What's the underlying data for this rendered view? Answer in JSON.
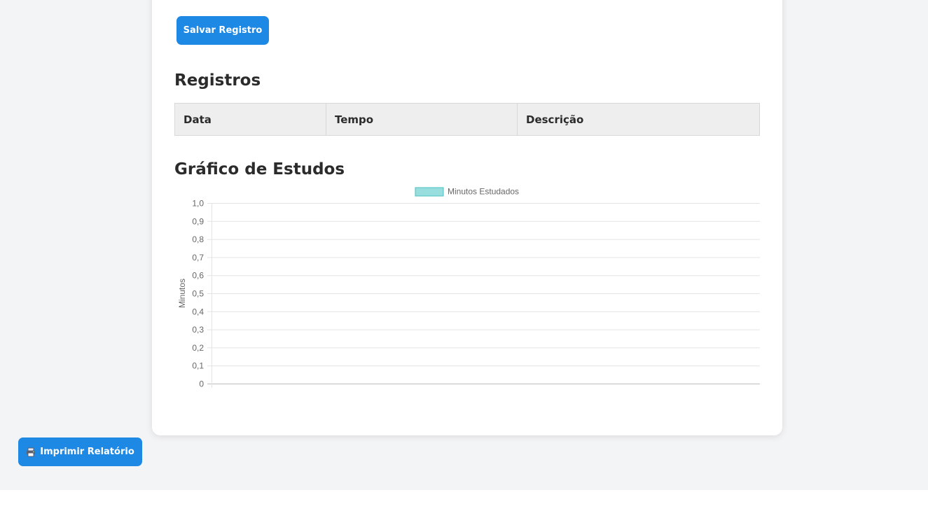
{
  "save_button": {
    "label": "Salvar Registro"
  },
  "records": {
    "heading": "Registros",
    "columns": [
      "Data",
      "Tempo",
      "Descrição"
    ],
    "rows": []
  },
  "chart_section": {
    "heading": "Gráfico de Estudos"
  },
  "print_button": {
    "label": "Imprimir Relatório",
    "icon": "printer-icon"
  },
  "colors": {
    "accent": "#1e88e5",
    "series_fill": "#99dede",
    "series_border": "#4bc0c0"
  },
  "chart_data": {
    "type": "bar",
    "categories": [],
    "series": [
      {
        "name": "Minutos Estudados",
        "values": []
      }
    ],
    "title": "",
    "xlabel": "",
    "ylabel": "Minutos",
    "ylim": [
      0,
      1.0
    ],
    "yticks": [
      "0",
      "0,1",
      "0,2",
      "0,3",
      "0,4",
      "0,5",
      "0,6",
      "0,7",
      "0,8",
      "0,9",
      "1,0"
    ],
    "grid": true,
    "legend": "top-center"
  }
}
